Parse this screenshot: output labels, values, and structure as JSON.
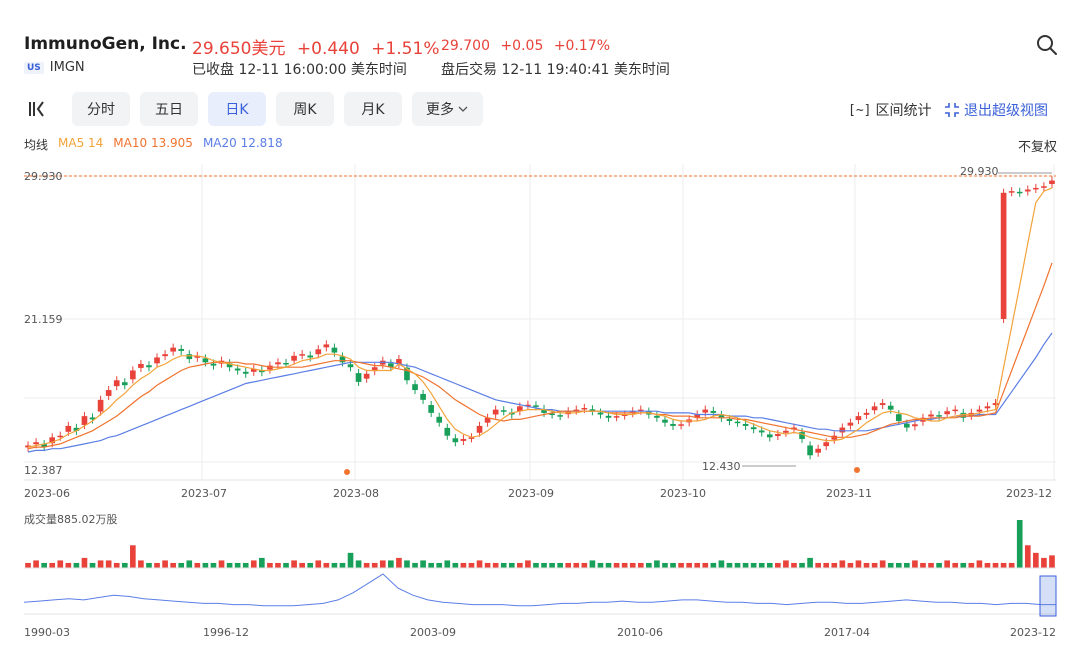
{
  "header": {
    "company": "ImmunoGen, Inc.",
    "price": "29.650美元",
    "change": "+0.440",
    "change_pct": "+1.51%",
    "after_price": "29.700",
    "after_change": "+0.05",
    "after_pct": "+0.17%",
    "market_badge": "US",
    "ticker": "IMGN",
    "status": "已收盘 12-11 16:00:00 美东时间",
    "after_status": "盘后交易 12-11 19:40:41 美东时间",
    "up_color": "#e8423a",
    "down_color": "#18a05a"
  },
  "toolbar": {
    "tabs": [
      "分时",
      "五日",
      "日K",
      "周K",
      "月K",
      "更多"
    ],
    "active_tab": "日K",
    "range_stats": "区间统计",
    "exit_super": "退出超级视图"
  },
  "ma_legend": {
    "label": "均线",
    "ma5": "MA5 14",
    "ma10": "MA10 13.905",
    "ma20": "MA20 12.818",
    "ma5_color": "#f2a33a",
    "ma10_color": "#f0732f",
    "ma20_color": "#5b7ee5"
  },
  "fuquan": "不复权",
  "chart_data": {
    "type": "candlestick",
    "y_ticks": [
      "29.930",
      "21.159",
      "12.387"
    ],
    "ylim": [
      12.387,
      29.93
    ],
    "x_ticks": [
      "2023-06",
      "2023-07",
      "2023-08",
      "2023-09",
      "2023-10",
      "2023-11",
      "2023-12"
    ],
    "high_label": "29.930",
    "low_label": "12.430",
    "dashed_line_value": 29.93,
    "closes": [
      13.4,
      13.6,
      13.3,
      13.9,
      14.0,
      14.6,
      14.3,
      15.2,
      15.0,
      16.2,
      16.8,
      17.4,
      17.1,
      18.0,
      18.4,
      18.2,
      18.8,
      19.0,
      19.4,
      19.2,
      18.7,
      18.9,
      18.5,
      18.3,
      18.6,
      18.2,
      18.0,
      17.8,
      18.1,
      17.9,
      18.3,
      18.5,
      18.4,
      18.9,
      19.0,
      18.8,
      19.3,
      19.6,
      19.1,
      18.5,
      18.2,
      17.3,
      17.8,
      18.2,
      18.6,
      18.2,
      18.7,
      17.4,
      16.8,
      16.2,
      15.4,
      14.8,
      14.0,
      13.6,
      13.8,
      13.9,
      14.6,
      15.1,
      15.6,
      15.5,
      15.3,
      15.8,
      15.9,
      15.8,
      15.4,
      15.3,
      15.2,
      15.5,
      15.6,
      15.7,
      15.5,
      15.3,
      15.1,
      15.2,
      15.3,
      15.5,
      15.6,
      15.3,
      15.1,
      14.8,
      14.6,
      14.7,
      15.0,
      15.3,
      15.6,
      15.4,
      15.1,
      14.9,
      14.8,
      14.6,
      14.4,
      14.2,
      13.9,
      14.1,
      14.3,
      14.5,
      13.8,
      12.8,
      13.2,
      13.6,
      14.0,
      14.5,
      14.8,
      15.2,
      15.4,
      15.8,
      16.0,
      15.6,
      14.9,
      14.5,
      14.7,
      15.1,
      15.3,
      15.2,
      15.5,
      15.6,
      15.1,
      15.4,
      15.6,
      15.8,
      16.0,
      28.9,
      29.0,
      28.9,
      29.1,
      29.2,
      29.3,
      29.65
    ],
    "ma5": [
      13.3,
      13.4,
      13.5,
      13.6,
      13.8,
      14.1,
      14.3,
      14.6,
      14.9,
      15.3,
      15.7,
      16.2,
      16.6,
      17.1,
      17.5,
      17.8,
      18.2,
      18.4,
      18.7,
      18.9,
      18.9,
      18.9,
      18.8,
      18.6,
      18.5,
      18.4,
      18.3,
      18.2,
      18.1,
      18.0,
      18.0,
      18.1,
      18.2,
      18.4,
      18.6,
      18.7,
      18.8,
      19.0,
      19.0,
      18.9,
      18.7,
      18.2,
      18.0,
      18.0,
      18.0,
      18.0,
      18.4,
      18.1,
      17.8,
      17.3,
      16.6,
      15.8,
      15.0,
      14.4,
      14.1,
      13.9,
      14.0,
      14.3,
      14.7,
      15.1,
      15.4,
      15.5,
      15.6,
      15.6,
      15.6,
      15.5,
      15.4,
      15.4,
      15.4,
      15.5,
      15.5,
      15.5,
      15.4,
      15.3,
      15.3,
      15.3,
      15.4,
      15.4,
      15.3,
      15.2,
      15.0,
      14.9,
      14.9,
      14.9,
      15.0,
      15.2,
      15.3,
      15.2,
      15.1,
      14.9,
      14.7,
      14.5,
      14.3,
      14.2,
      14.1,
      14.2,
      14.1,
      13.9,
      13.8,
      13.7,
      13.7,
      13.8,
      14.1,
      14.4,
      14.8,
      15.1,
      15.4,
      15.5,
      15.4,
      15.3,
      15.1,
      15.0,
      14.9,
      14.9,
      15.1,
      15.2,
      15.3,
      15.3,
      15.4,
      15.5,
      15.6,
      18.2,
      20.7,
      23.2,
      25.8,
      28.3,
      29.0,
      29.2
    ],
    "ma10": [
      13.2,
      13.3,
      13.3,
      13.4,
      13.5,
      13.7,
      13.9,
      14.1,
      14.3,
      14.6,
      14.9,
      15.2,
      15.6,
      16.0,
      16.4,
      16.7,
      17.1,
      17.4,
      17.7,
      18.0,
      18.2,
      18.3,
      18.4,
      18.5,
      18.5,
      18.5,
      18.5,
      18.4,
      18.4,
      18.3,
      18.2,
      18.2,
      18.2,
      18.2,
      18.2,
      18.3,
      18.4,
      18.5,
      18.6,
      18.6,
      18.6,
      18.5,
      18.4,
      18.3,
      18.3,
      18.2,
      18.1,
      18.0,
      17.8,
      17.6,
      17.3,
      17.0,
      16.6,
      16.2,
      15.9,
      15.6,
      15.3,
      15.1,
      15.0,
      14.9,
      15.0,
      15.0,
      15.1,
      15.2,
      15.3,
      15.4,
      15.5,
      15.5,
      15.5,
      15.5,
      15.5,
      15.5,
      15.4,
      15.4,
      15.4,
      15.4,
      15.4,
      15.4,
      15.3,
      15.3,
      15.2,
      15.2,
      15.2,
      15.1,
      15.1,
      15.1,
      15.1,
      15.1,
      15.0,
      15.0,
      14.9,
      14.8,
      14.7,
      14.6,
      14.5,
      14.4,
      14.3,
      14.2,
      14.1,
      14.0,
      13.9,
      13.9,
      13.9,
      14.0,
      14.1,
      14.3,
      14.5,
      14.7,
      14.8,
      14.9,
      15.0,
      15.0,
      15.1,
      15.1,
      15.1,
      15.1,
      15.2,
      15.2,
      15.2,
      15.3,
      15.4,
      16.7,
      18.0,
      19.3,
      20.6,
      21.9,
      23.2,
      24.6
    ],
    "ma20": [
      13.0,
      13.1,
      13.1,
      13.2,
      13.2,
      13.3,
      13.4,
      13.5,
      13.6,
      13.7,
      13.9,
      14.0,
      14.2,
      14.4,
      14.6,
      14.8,
      15.0,
      15.2,
      15.4,
      15.6,
      15.8,
      16.0,
      16.2,
      16.4,
      16.6,
      16.8,
      17.0,
      17.2,
      17.3,
      17.4,
      17.5,
      17.6,
      17.7,
      17.8,
      17.9,
      18.0,
      18.1,
      18.2,
      18.3,
      18.4,
      18.5,
      18.5,
      18.5,
      18.5,
      18.5,
      18.5,
      18.4,
      18.3,
      18.2,
      18.0,
      17.8,
      17.6,
      17.4,
      17.2,
      17.0,
      16.8,
      16.6,
      16.4,
      16.2,
      16.1,
      16.0,
      15.9,
      15.8,
      15.7,
      15.6,
      15.6,
      15.5,
      15.5,
      15.5,
      15.5,
      15.5,
      15.5,
      15.5,
      15.5,
      15.5,
      15.5,
      15.5,
      15.5,
      15.5,
      15.4,
      15.4,
      15.4,
      15.4,
      15.3,
      15.3,
      15.3,
      15.3,
      15.2,
      15.2,
      15.2,
      15.1,
      15.1,
      15.0,
      14.9,
      14.8,
      14.7,
      14.6,
      14.5,
      14.4,
      14.4,
      14.3,
      14.3,
      14.3,
      14.3,
      14.3,
      14.4,
      14.5,
      14.6,
      14.7,
      14.8,
      14.9,
      15.0,
      15.0,
      15.1,
      15.1,
      15.2,
      15.2,
      15.2,
      15.3,
      15.3,
      15.3,
      16.0,
      16.7,
      17.4,
      18.1,
      18.8,
      19.6,
      20.3
    ],
    "volume_label": "成交量885.02万股",
    "volume": [
      2,
      3,
      2,
      2,
      3,
      2,
      2,
      4,
      2,
      3,
      3,
      2,
      2,
      9,
      3,
      2,
      2,
      3,
      2,
      2,
      3,
      2,
      2,
      2,
      3,
      2,
      2,
      2,
      3,
      4,
      2,
      2,
      2,
      3,
      2,
      2,
      3,
      2,
      2,
      2,
      6,
      3,
      2,
      2,
      3,
      3,
      4,
      3,
      2,
      3,
      2,
      2,
      3,
      2,
      2,
      2,
      3,
      2,
      2,
      2,
      2,
      2,
      3,
      2,
      2,
      2,
      2,
      2,
      2,
      2,
      3,
      2,
      2,
      2,
      2,
      2,
      2,
      2,
      3,
      2,
      2,
      2,
      2,
      2,
      2,
      2,
      3,
      2,
      2,
      2,
      2,
      2,
      2,
      2,
      3,
      2,
      2,
      4,
      2,
      2,
      2,
      3,
      2,
      3,
      2,
      2,
      3,
      2,
      2,
      2,
      3,
      2,
      2,
      2,
      3,
      2,
      2,
      2,
      3,
      2,
      2,
      2,
      2,
      19,
      9,
      6,
      4,
      5,
      4,
      3
    ],
    "overview_ticks": [
      "1990-03",
      "1996-12",
      "2003-09",
      "2010-06",
      "2017-04",
      "2023-12"
    ],
    "overview": [
      10,
      11,
      12,
      13,
      12,
      14,
      16,
      15,
      13,
      12,
      11,
      10,
      9,
      9,
      8,
      8,
      7,
      7,
      7,
      8,
      9,
      12,
      18,
      26,
      34,
      22,
      16,
      12,
      10,
      9,
      8,
      8,
      8,
      7,
      7,
      8,
      9,
      9,
      10,
      10,
      11,
      10,
      10,
      11,
      12,
      12,
      11,
      10,
      10,
      9,
      9,
      8,
      9,
      10,
      10,
      9,
      9,
      10,
      11,
      12,
      11,
      10,
      10,
      9,
      9,
      8,
      9,
      9,
      8,
      8
    ]
  }
}
